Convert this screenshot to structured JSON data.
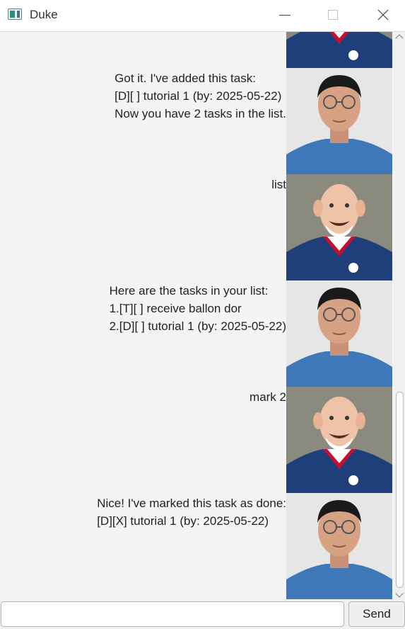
{
  "window": {
    "title": "Duke",
    "icons": {
      "app": "app-window-icon",
      "minimize": "minimize-icon",
      "maximize": "maximize-icon",
      "close": "close-icon"
    }
  },
  "conversation": [
    {
      "sender": "duke",
      "text": "",
      "avatar": "duke-avatar"
    },
    {
      "sender": "duke",
      "text": "Got it. I've added this task:\n[D][ ] tutorial 1 (by: 2025-05-22)\nNow you have 2 tasks in the list.",
      "avatar": "duke-avatar"
    },
    {
      "sender": "user",
      "text": "list",
      "avatar": "user-avatar"
    },
    {
      "sender": "duke",
      "text": "Here are the tasks in your list:\n1.[T][ ] receive ballon dor\n2.[D][ ] tutorial 1 (by: 2025-05-22)",
      "avatar": "duke-avatar"
    },
    {
      "sender": "user",
      "text": "mark 2",
      "avatar": "user-avatar"
    },
    {
      "sender": "duke",
      "text": "Nice! I've marked this task as done:\n[D][X] tutorial 1 (by: 2025-05-22)",
      "avatar": "duke-avatar"
    }
  ],
  "input": {
    "value": "",
    "placeholder": ""
  },
  "send_button": {
    "label": "Send"
  },
  "colors": {
    "background": "#f4f4f4",
    "jersey": "#1f4e8c",
    "jersey_stripe": "#c8102e"
  }
}
